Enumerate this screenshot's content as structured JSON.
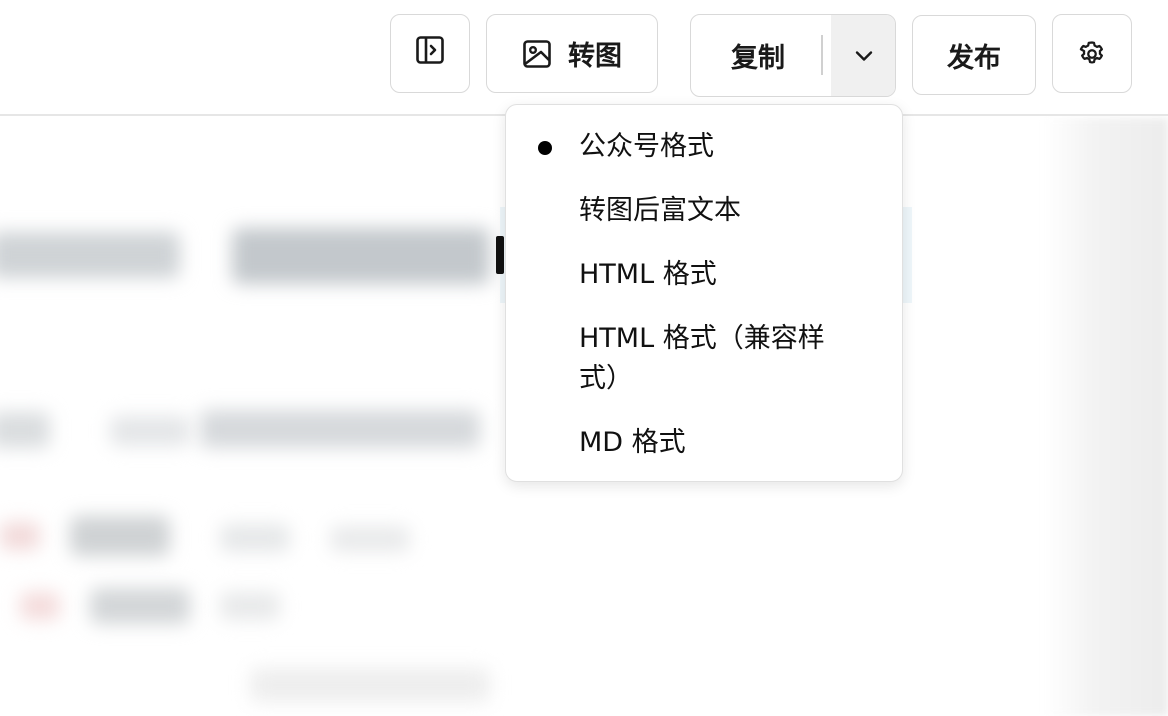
{
  "toolbar": {
    "sidebar_toggle_icon": "sidebar-toggle-icon",
    "convert_label": "转图",
    "convert_icon": "image-icon",
    "copy_label": "复制",
    "copy_dropdown_icon": "chevron-down-icon",
    "publish_label": "发布",
    "settings_icon": "gear-icon"
  },
  "copy_menu": {
    "selected_index": 0,
    "items": [
      {
        "label": "公众号格式",
        "selected": true
      },
      {
        "label": "转图后富文本",
        "selected": false
      },
      {
        "label": "HTML 格式",
        "selected": false
      },
      {
        "label": "HTML 格式（兼容样式）",
        "selected": false
      },
      {
        "label": "MD 格式",
        "selected": false
      }
    ]
  },
  "colors": {
    "border": "#d9d9d9",
    "menu_border": "#e0e0e0",
    "dropdown_arrow_bg": "#f0f0f0",
    "title_band": "#eef6fa"
  }
}
